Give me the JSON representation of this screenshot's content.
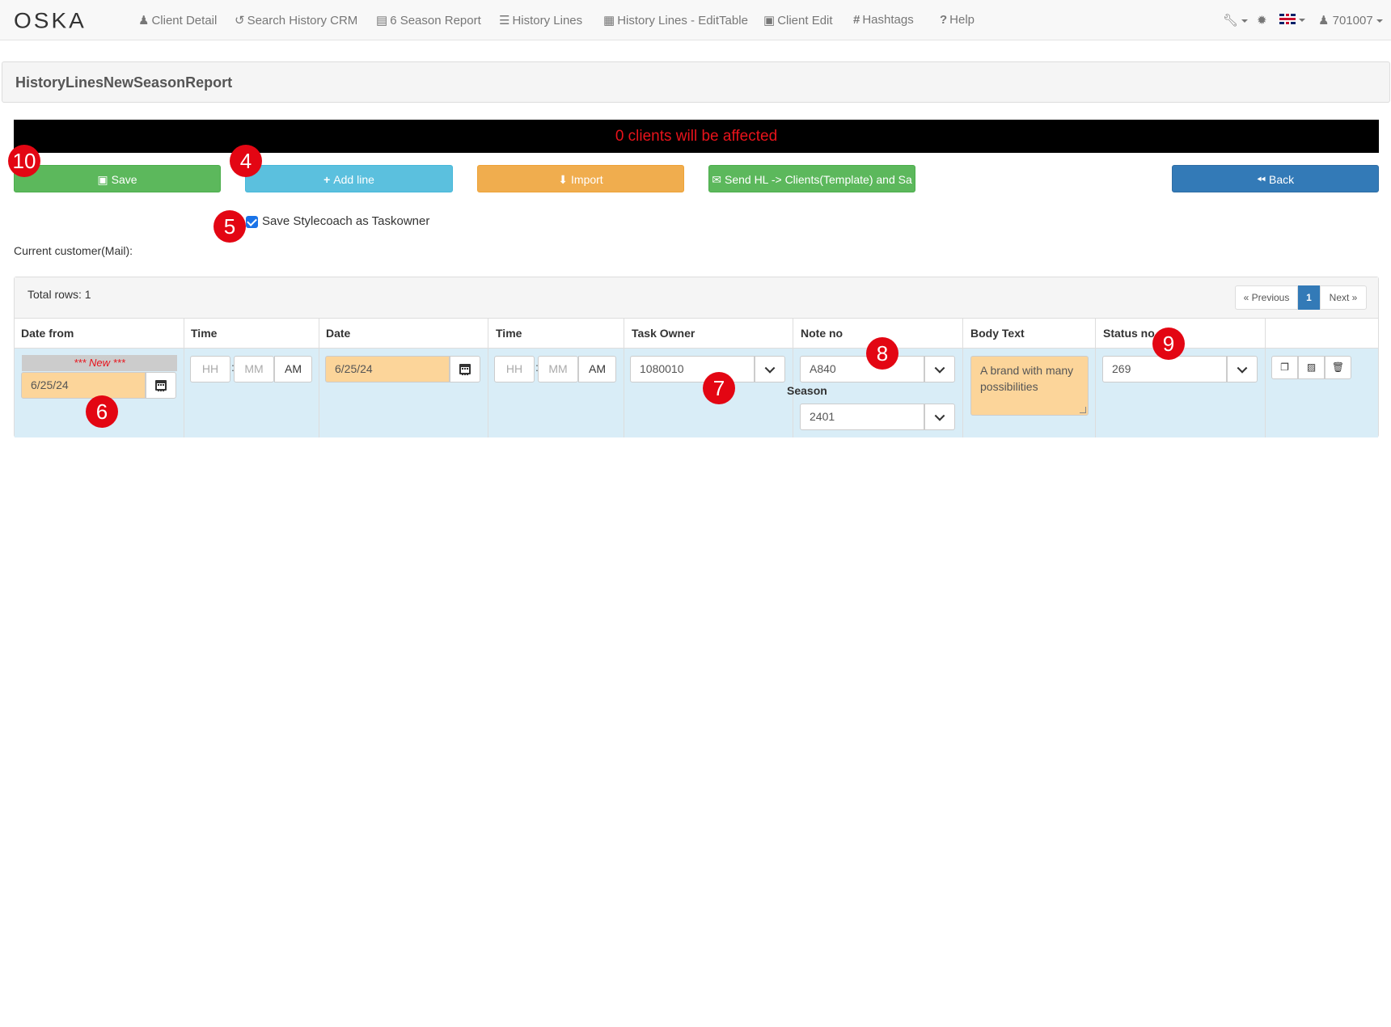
{
  "nav": {
    "brand": "OSKA",
    "items": [
      {
        "icon": "user-icon",
        "glyph": "♟",
        "label": "Client Detail"
      },
      {
        "icon": "history-icon",
        "glyph": "↺",
        "label": "Search History CRM"
      },
      {
        "icon": "list-alt-icon",
        "glyph": "▤",
        "label": "6 Season Report"
      },
      {
        "icon": "list-icon",
        "glyph": "☰",
        "label": "History Lines"
      },
      {
        "icon": "table-icon",
        "glyph": "▦",
        "label": "History Lines - EditTable"
      },
      {
        "icon": "contact-card-icon",
        "glyph": "▣",
        "label": "Client Edit"
      },
      {
        "icon": "hash-icon",
        "glyph": "#",
        "label": "Hashtags"
      },
      {
        "icon": "question-icon",
        "glyph": "?",
        "label": "Help"
      }
    ],
    "user": "701007"
  },
  "panel": {
    "title": "HistoryLinesNewSeasonReport"
  },
  "banner": {
    "text": "0 clients will be affected"
  },
  "buttons": {
    "save": "Save",
    "add_line": "Add line",
    "import": "Import",
    "send": "Send HL -> Clients(Template) and Sa",
    "back": "Back"
  },
  "checkbox": {
    "label": "Save Stylecoach as Taskowner",
    "checked": true
  },
  "customer": {
    "label": "Current customer(Mail):"
  },
  "table": {
    "total_rows": "Total rows: 1",
    "pager": {
      "prev": "« Previous",
      "page": "1",
      "next": "Next »"
    },
    "headers": [
      "Date from",
      "Time",
      "Date",
      "Time",
      "Task Owner",
      "Note no",
      "Body Text",
      "Status no"
    ],
    "row": {
      "new_tag": "*** New ***",
      "date_from": "6/25/24",
      "time1": {
        "hh": "HH",
        "mm": "MM",
        "ampm": "AM"
      },
      "date": "6/25/24",
      "time2": {
        "hh": "HH",
        "mm": "MM",
        "ampm": "AM"
      },
      "task_owner": "1080010",
      "note_no": "A840",
      "season_label": "Season",
      "season": "2401",
      "body_text": "A brand with many possibilities",
      "status_no": "269"
    }
  },
  "markers": [
    "10",
    "4",
    "5",
    "6",
    "7",
    "8",
    "9"
  ],
  "colors": {
    "success": "#5cb85c",
    "info": "#5bc0de",
    "warning": "#f0ad4e",
    "primary": "#337ab7",
    "marker": "#e30613",
    "row": "#d9edf7",
    "highlight": "#fcd59a"
  }
}
